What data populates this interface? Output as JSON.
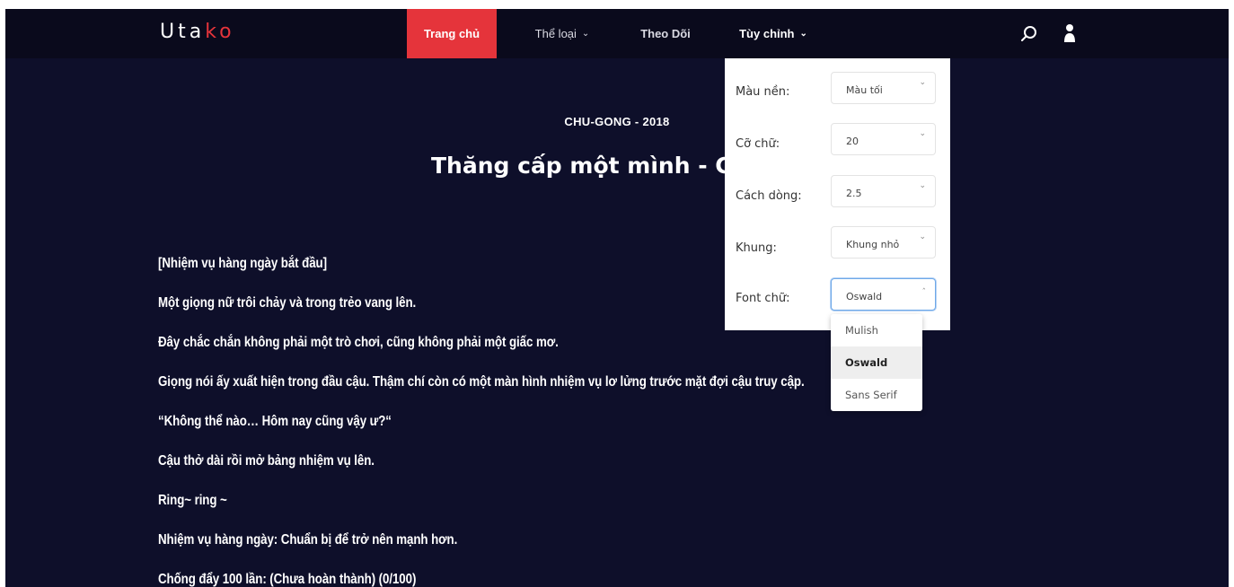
{
  "navbar": {
    "logo_main": "Uta",
    "logo_accent": "ko",
    "home": "Trang chủ",
    "genre": "Thể loại",
    "follow": "Theo Dõi",
    "custom": "Tùy chỉnh"
  },
  "story": {
    "meta": "CHU-GONG - 2018",
    "chapter_title": "Thăng cấp một mình - Ch"
  },
  "content": {
    "paragraphs": [
      "[Nhiệm vụ hàng ngày bắt đầu]",
      "Một giọng nữ trôi chảy và trong trẻo vang lên.",
      "Đây chắc chắn không phải một trò chơi, cũng không phải một giấc mơ.",
      "Giọng nói ấy xuất hiện trong đầu cậu. Thậm chí còn có một màn hình nhiệm vụ lơ lửng trước mặt đợi cậu truy cập.",
      "“Không thể nào… Hôm nay cũng vậy ư?“",
      "Cậu thở dài rồi mở bảng nhiệm vụ lên.",
      "Ring~ ring ~",
      "Nhiệm vụ hàng ngày: Chuẩn bị để trở nên mạnh hơn.",
      "Chống đẩy 100 lần: (Chưa hoàn thành) (0/100)"
    ]
  },
  "settings": {
    "bg_label": "Màu nền:",
    "bg_value": "Màu tối",
    "size_label": "Cỡ chữ:",
    "size_value": "20",
    "line_label": "Cách dòng:",
    "line_value": "2.5",
    "frame_label": "Khung:",
    "frame_value": "Khung nhỏ",
    "font_label": "Font chữ:",
    "font_value": "Oswald",
    "font_options": [
      "Mulish",
      "Oswald",
      "Sans Serif"
    ]
  },
  "colors": {
    "background": "#0e0f2a",
    "navbar": "#0a0a1c",
    "accent": "#e5343b"
  },
  "icons": {
    "search": "search-icon",
    "user": "user-icon",
    "chevron": "chevron-down-icon"
  }
}
